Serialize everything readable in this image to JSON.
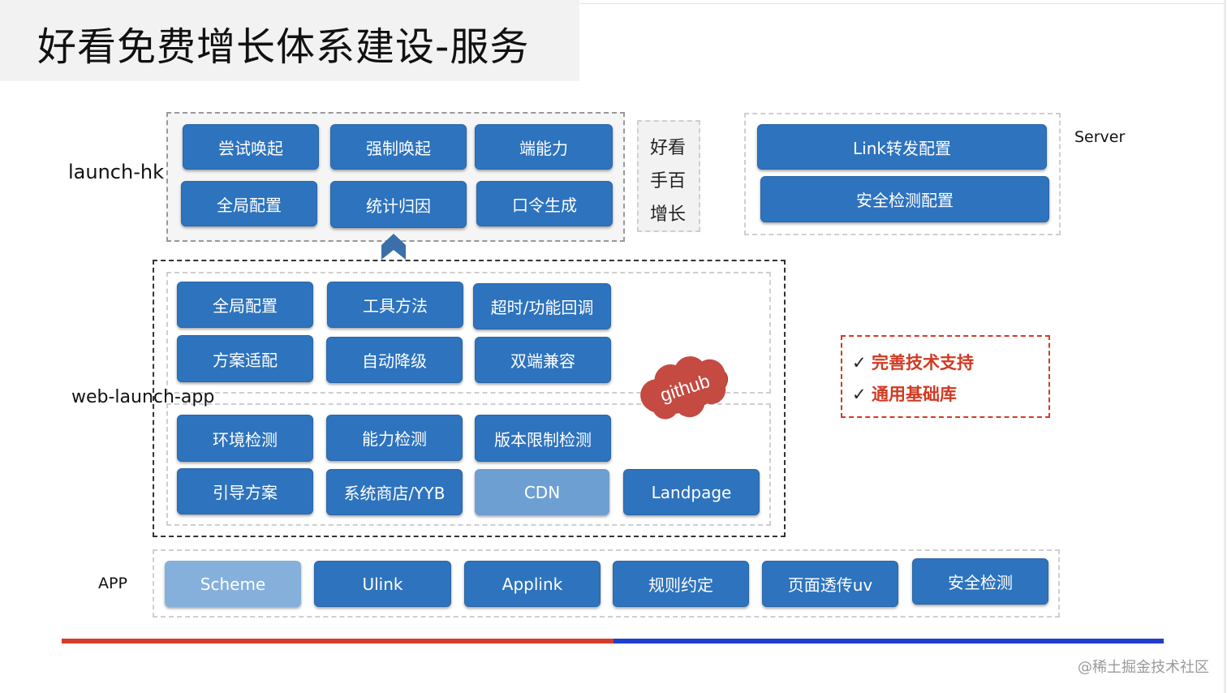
{
  "title": "好看免费增长体系建设-服务",
  "labels": {
    "launch_hk": "launch-hk",
    "web_launch_app": "web-launch-app",
    "app": "APP",
    "server": "Server"
  },
  "launch_hk": {
    "row1": [
      "尝试唤起",
      "强制唤起",
      "端能力"
    ],
    "row2": [
      "全局配置",
      "统计归因",
      "口令生成"
    ]
  },
  "side_box": [
    "好看",
    "手百",
    "增长"
  ],
  "server": [
    "Link转发配置",
    "安全检测配置"
  ],
  "web_launch_app": {
    "upper_row1": [
      "全局配置",
      "工具方法",
      "超时/功能回调"
    ],
    "upper_row2": [
      "方案适配",
      "自动降级",
      "双端兼容"
    ],
    "lower_row1": [
      "环境检测",
      "能力检测",
      "版本限制检测"
    ],
    "lower_row2": [
      "引导方案",
      "系统商店/YYB",
      "CDN",
      "Landpage"
    ]
  },
  "cloud_label": "github",
  "app_row": [
    "Scheme",
    "Ulink",
    "Applink",
    "规则约定",
    "页面透传uv",
    "安全检测"
  ],
  "notes": [
    "完善技术支持",
    "通用基础库"
  ],
  "check_mark": "✓",
  "watermark": "@稀土掘金技术社区",
  "colors": {
    "button_blue": "#2e73bd",
    "button_light": "#6e9fd2",
    "note_red": "#d03a22",
    "bar_red": "#d63b2a",
    "bar_blue": "#1f3fd0"
  }
}
